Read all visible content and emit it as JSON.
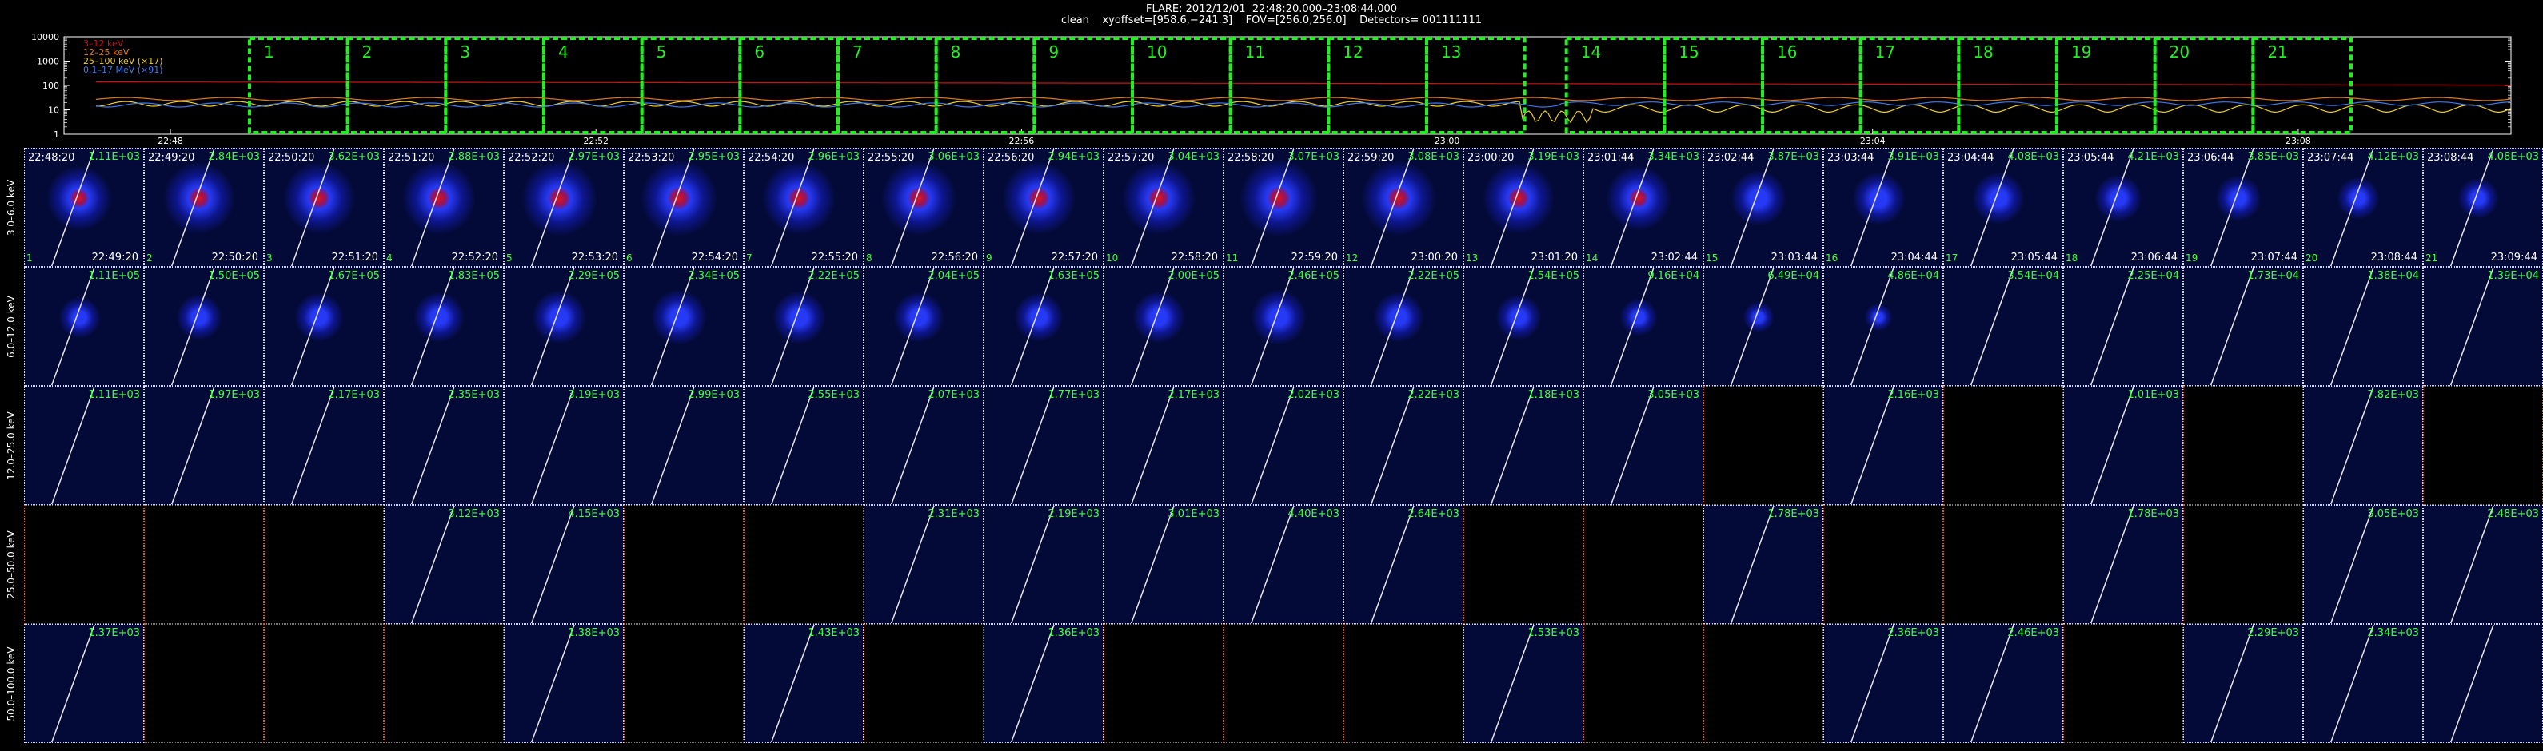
{
  "header": {
    "line1": "FLARE: 2012/12/01  22:48:20.000–23:08:44.000",
    "line2": "clean    xyoffset=[958.6,−241.3]    FOV=[256.0,256.0]    Detectors= 001111111"
  },
  "lightcurve": {
    "y_ticks": [
      "10000",
      "1000",
      "100",
      "10",
      "1"
    ],
    "x_ticks": [
      "22:48",
      "22:52",
      "22:56",
      "23:00",
      "23:04",
      "23:08"
    ],
    "legend": [
      {
        "label": "3–12 keV",
        "color": "#c81414"
      },
      {
        "label": "12–25 keV",
        "color": "#e07818"
      },
      {
        "label": "25–100 keV (×17)",
        "color": "#f0d020"
      },
      {
        "label": "0.1–17 MeV (×91)",
        "color": "#3c78f0"
      }
    ],
    "intervals": [
      "1",
      "2",
      "3",
      "4",
      "5",
      "6",
      "7",
      "8",
      "9",
      "10",
      "11",
      "12",
      "13",
      "14",
      "15",
      "16",
      "17",
      "18",
      "19",
      "20",
      "21"
    ],
    "interval_color": "#22ee22"
  },
  "energy_rows": [
    "3.0–6.0 keV",
    "6.0–12.0 keV",
    "12.0–25.0 keV",
    "25.0–50.0 keV",
    "50.0–100.0 keV"
  ],
  "start_times": [
    "22:48:20",
    "22:49:20",
    "22:50:20",
    "22:51:20",
    "22:52:20",
    "22:53:20",
    "22:54:20",
    "22:55:20",
    "22:56:20",
    "22:57:20",
    "22:58:20",
    "22:59:20",
    "23:00:20",
    "23:01:44",
    "23:02:44",
    "23:03:44",
    "23:04:44",
    "23:05:44",
    "23:06:44",
    "23:07:44",
    "23:08:44"
  ],
  "end_times": [
    "22:49:20",
    "22:50:20",
    "22:51:20",
    "22:52:20",
    "22:53:20",
    "22:54:20",
    "22:55:20",
    "22:56:20",
    "22:57:20",
    "22:58:20",
    "22:59:20",
    "23:00:20",
    "23:01:20",
    "23:02:44",
    "23:03:44",
    "23:04:44",
    "23:05:44",
    "23:06:44",
    "23:07:44",
    "23:08:44",
    "23:09:44"
  ],
  "panel_numbers": [
    "1",
    "2",
    "3",
    "4",
    "5",
    "6",
    "7",
    "8",
    "9",
    "10",
    "11",
    "12",
    "13",
    "14",
    "15",
    "16",
    "17",
    "18",
    "19",
    "20",
    "21"
  ],
  "counts": [
    [
      "1.11E+03",
      "2.84E+03",
      "3.62E+03",
      "2.88E+03",
      "2.97E+03",
      "2.95E+03",
      "2.96E+03",
      "3.06E+03",
      "2.94E+03",
      "3.04E+03",
      "3.07E+03",
      "3.08E+03",
      "3.19E+03",
      "3.34E+03",
      "3.87E+03",
      "3.91E+03",
      "4.08E+03",
      "4.21E+03",
      "3.85E+03",
      "4.12E+03",
      "4.08E+03"
    ],
    [
      "1.11E+05",
      "1.50E+05",
      "1.67E+05",
      "1.83E+05",
      "2.29E+05",
      "2.34E+05",
      "2.22E+05",
      "2.04E+05",
      "1.63E+05",
      "2.00E+05",
      "2.46E+05",
      "2.22E+05",
      "1.54E+05",
      "9.16E+04",
      "6.49E+04",
      "4.86E+04",
      "3.54E+04",
      "2.25E+04",
      "1.73E+04",
      "1.38E+04",
      "1.39E+04"
    ],
    [
      "1.11E+03",
      "1.97E+03",
      "2.17E+03",
      "2.35E+03",
      "3.19E+03",
      "2.99E+03",
      "2.55E+03",
      "2.07E+03",
      "1.77E+03",
      "2.17E+03",
      "2.02E+03",
      "2.22E+03",
      "1.18E+03",
      "3.05E+03",
      "",
      "2.16E+03",
      "",
      "1.01E+03",
      "",
      "7.82E+03",
      ""
    ],
    [
      "",
      "",
      "",
      "3.12E+03",
      "4.15E+03",
      "",
      "",
      "2.31E+03",
      "2.19E+03",
      "3.01E+03",
      "4.40E+03",
      "2.64E+03",
      "",
      "",
      "1.78E+03",
      "",
      "",
      "1.78E+03",
      "",
      "3.05E+03",
      "2.48E+03"
    ],
    [
      "1.37E+03",
      "",
      "",
      "",
      "1.38E+03",
      "",
      "1.43E+03",
      "",
      "1.36E+03",
      "",
      "",
      "",
      "1.53E+03",
      "",
      "",
      "2.36E+03",
      "2.46E+03",
      "",
      "2.29E+03",
      "2.34E+03",
      ""
    ]
  ],
  "intensity": [
    [
      0.72,
      0.82,
      0.84,
      0.86,
      0.9,
      0.92,
      0.85,
      0.88,
      0.86,
      0.87,
      0.94,
      0.88,
      0.84,
      0.72,
      0.55,
      0.5,
      0.48,
      0.4,
      0.36,
      0.32,
      0.28
    ],
    [
      0.3,
      0.38,
      0.42,
      0.45,
      0.52,
      0.55,
      0.5,
      0.46,
      0.42,
      0.48,
      0.55,
      0.46,
      0.36,
      0.22,
      0.12,
      0.05,
      0.02,
      0.02,
      0.01,
      0.01,
      0.01
    ],
    [
      0.02,
      0.02,
      0.02,
      0.02,
      0.02,
      0.02,
      0.02,
      0.02,
      0.02,
      0.02,
      0.02,
      0.02,
      0.02,
      0.02,
      0,
      0.02,
      0,
      0.02,
      0,
      0.02,
      0
    ],
    [
      0,
      0,
      0,
      0.02,
      0.02,
      0,
      0,
      0.02,
      0.02,
      0.02,
      0.02,
      0.02,
      0,
      0,
      0.02,
      0,
      0,
      0.02,
      0,
      0.02,
      0.02
    ],
    [
      0.02,
      0,
      0,
      0,
      0.02,
      0,
      0.02,
      0,
      0.02,
      0,
      0,
      0,
      0.02,
      0,
      0,
      0.02,
      0.02,
      0,
      0.02,
      0.02,
      0
    ]
  ],
  "empty_panels": [
    [],
    [],
    [
      14,
      16,
      18,
      20
    ],
    [
      0,
      1,
      2,
      5,
      6,
      12,
      13,
      15,
      16,
      18
    ],
    [
      1,
      2,
      3,
      5,
      7,
      9,
      10,
      11,
      13,
      14,
      17
    ]
  ],
  "colors": {
    "panel_bg": "#040a38",
    "count_text": "#3cff3c",
    "limb": "#e8e8e8",
    "empty_border": "#e05a14"
  }
}
